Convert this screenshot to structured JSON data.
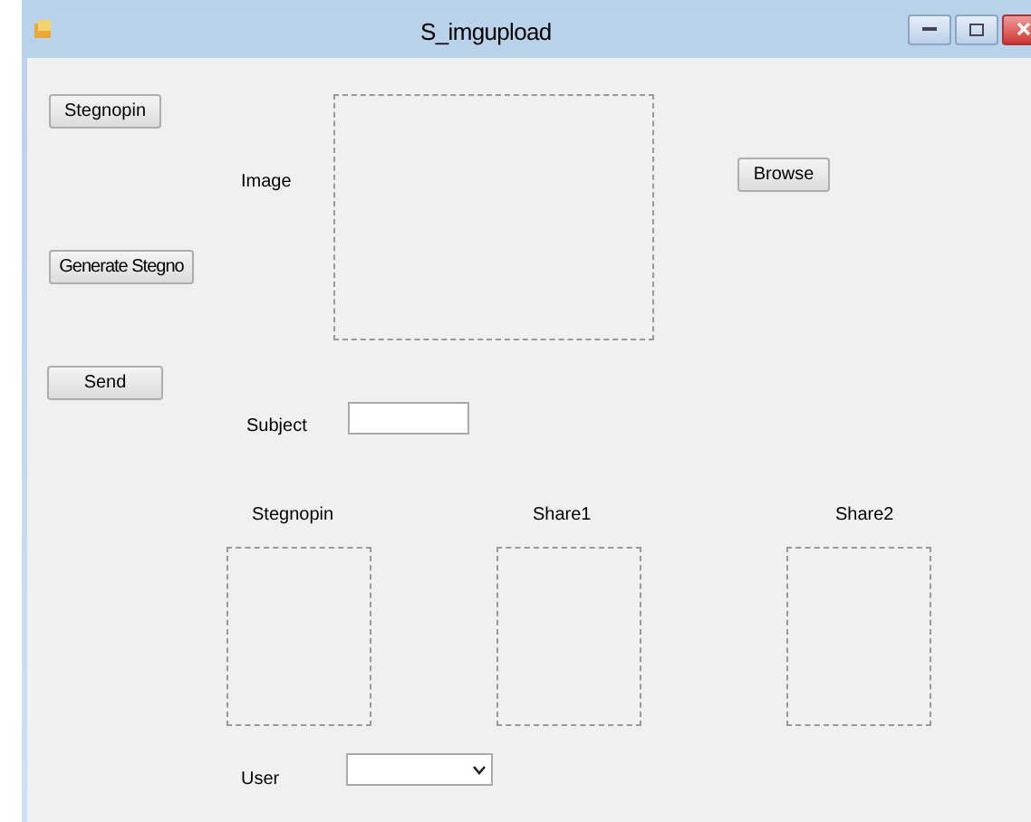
{
  "window": {
    "title": "S_imgupload"
  },
  "buttons": [
    {
      "label": "Stegnopin"
    },
    {
      "label": "Generate Stegno"
    },
    {
      "label": "Send"
    },
    {
      "label": "Browse"
    }
  ],
  "image_label": "Image",
  "subject": {
    "label": "Subject"
  },
  "previews": [
    {
      "label": "Stegnopin"
    },
    {
      "label": "Share1"
    },
    {
      "label": "Share2"
    }
  ],
  "user": {
    "label": "User"
  }
}
